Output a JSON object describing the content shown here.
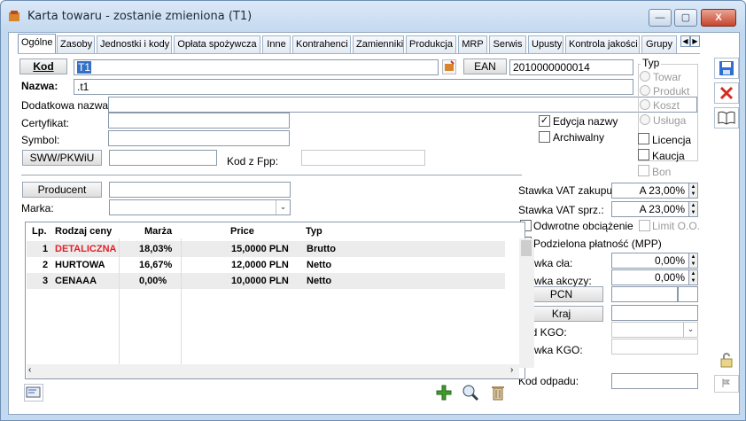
{
  "window": {
    "title": "Karta towaru - zostanie zmieniona (T1)",
    "minimize": "—",
    "maximize": "▢",
    "close": "X"
  },
  "tabs": [
    "Ogólne",
    "Zasoby",
    "Jednostki i kody",
    "Opłata spożywcza",
    "Inne",
    "Kontrahenci",
    "Zamienniki",
    "Produkcja",
    "MRP",
    "Serwis",
    "Upusty",
    "Kontrola jakości",
    "Grupy"
  ],
  "form": {
    "kod_button": "Kod",
    "kod_value": "T1",
    "ean_button": "EAN",
    "ean_value": "2010000000014",
    "nazwa_label": "Nazwa:",
    "nazwa_value": ".t1",
    "dodatkowa_label": "Dodatkowa nazwa:",
    "certyfikat_label": "Certyfikat:",
    "symbol_label": "Symbol:",
    "sww_button": "SWW/PKWiU",
    "kod_fpp_label": "Kod z Fpp:",
    "edycja_nazwy_label": "Edycja nazwy",
    "edycja_nazwy_checked": "✓",
    "archiwalny_label": "Archiwalny",
    "producent_button": "Producent",
    "marka_label": "Marka:"
  },
  "typ": {
    "label": "Typ",
    "options": [
      "Towar",
      "Produkt",
      "Koszt",
      "Usługa"
    ]
  },
  "flags": {
    "licencja": "Licencja",
    "kaucja": "Kaucja",
    "bon": "Bon"
  },
  "vat": {
    "zakupu_label": "Stawka VAT zakupu:",
    "zakupu_value": "A 23,00%",
    "sprz_label": "Stawka VAT sprz.:",
    "sprz_value": "A 23,00%",
    "odwrotne_label": "Odwrotne obciążenie",
    "limit_label": "Limit O.O.",
    "mpp_label": "Podzielona płatność (MPP)",
    "cla_label": "Stawka cła:",
    "cla_value": "0,00%",
    "akcyzy_label": "Stawka akcyzy:",
    "akcyzy_value": "0,00%",
    "pcn_button": "PCN",
    "kraj_button": "Kraj",
    "kgo_label": "Kod KGO:",
    "stawka_kgo_label": "Stawka KGO:",
    "odpadu_label": "Kod odpadu:"
  },
  "prices": {
    "headers": [
      "Lp.",
      "Rodzaj ceny",
      "Marża",
      "Price",
      "Typ"
    ],
    "rows": [
      {
        "lp": "1",
        "rodzaj": "DETALICZNA",
        "marza": "18,03%",
        "price": "15,0000 PLN",
        "typ": "Brutto"
      },
      {
        "lp": "2",
        "rodzaj": "HURTOWA",
        "marza": "16,67%",
        "price": "12,0000 PLN",
        "typ": "Netto"
      },
      {
        "lp": "3",
        "rodzaj": "CENAAA",
        "marza": "0,00%",
        "price": "10,0000 PLN",
        "typ": "Netto"
      }
    ],
    "highlight_color": "#e0202a"
  },
  "colors": {
    "window_bg": "#c3d9f0",
    "save": "#2f6fd1",
    "delete": "#d42b22",
    "add": "#3f9a2e"
  },
  "icons": {
    "save": "save-icon",
    "delete": "delete-icon",
    "book": "book-icon",
    "lock": "lock-icon",
    "pin": "pin-icon",
    "add": "add-icon",
    "search": "search-icon",
    "trash": "trash-icon",
    "card": "card-icon"
  }
}
